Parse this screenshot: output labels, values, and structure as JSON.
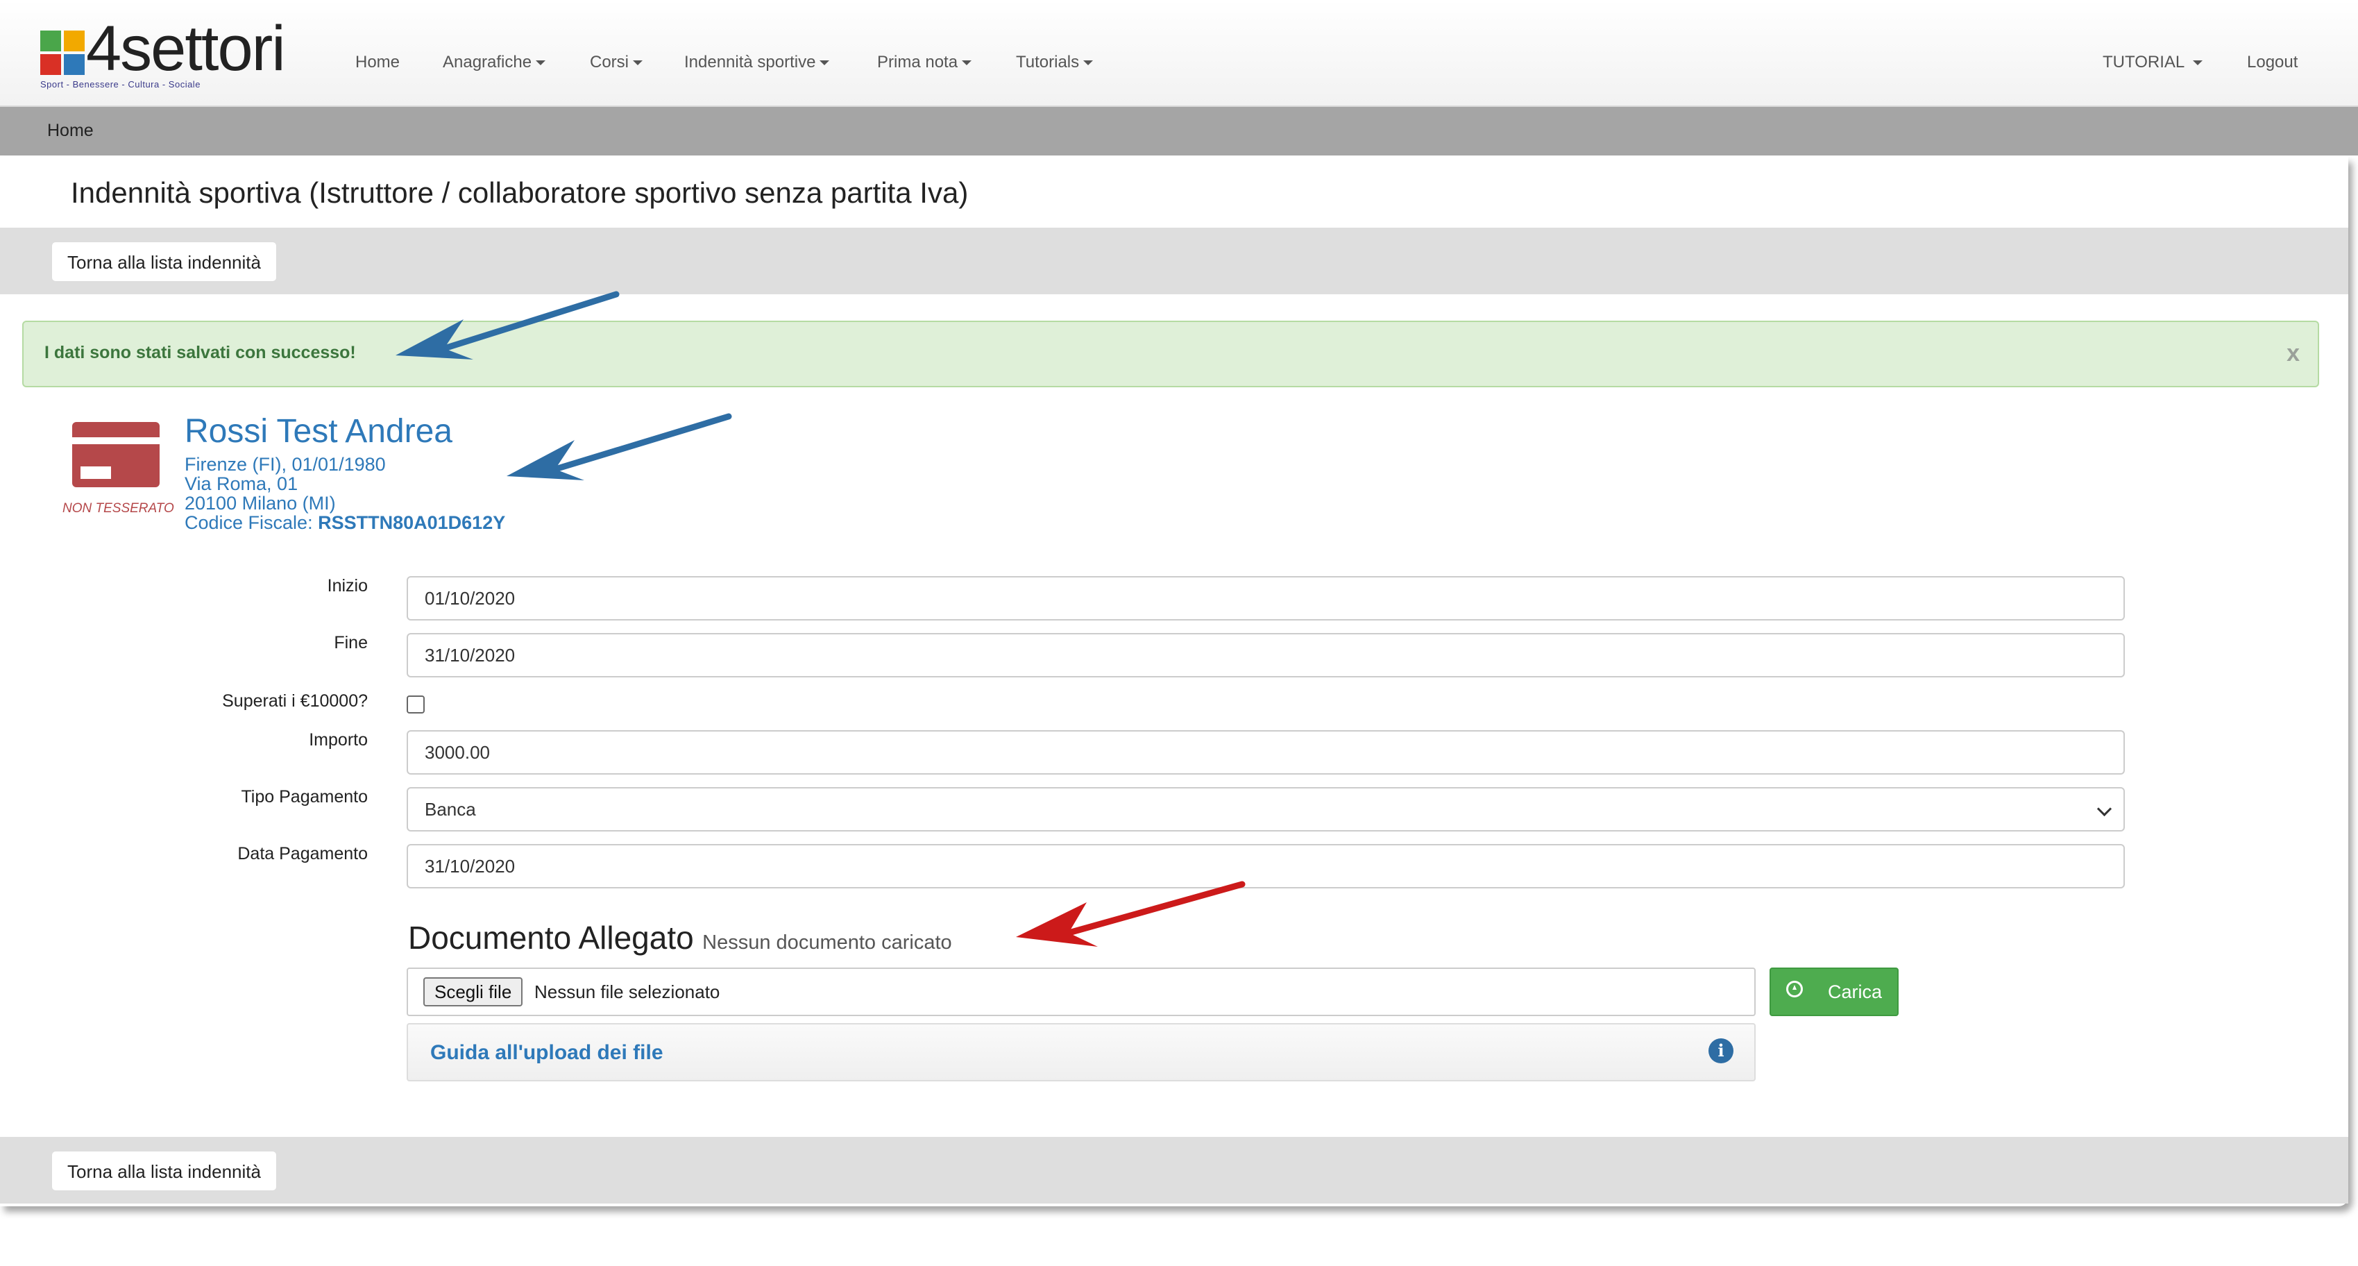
{
  "brand": {
    "name": "4settori",
    "tagline": "Sport - Benessere - Cultura - Sociale",
    "colors": [
      "#d93025",
      "#2e79b9",
      "#f2a900",
      "#4aa64a"
    ]
  },
  "nav": {
    "items": [
      {
        "label": "Home",
        "dropdown": false
      },
      {
        "label": "Anagrafiche",
        "dropdown": true
      },
      {
        "label": "Corsi",
        "dropdown": true
      },
      {
        "label": "Indennità sportive",
        "dropdown": true
      },
      {
        "label": "Prima nota",
        "dropdown": true
      },
      {
        "label": "Tutorials",
        "dropdown": true
      }
    ],
    "right": [
      {
        "label": "TUTORIAL",
        "dropdown": true
      },
      {
        "label": "Logout",
        "dropdown": false
      }
    ]
  },
  "breadcrumb": "Home",
  "page": {
    "title": "Indennità sportiva (Istruttore / collaboratore sportivo senza partita Iva)",
    "back_label": "Torna alla lista indennità",
    "alert": "I dati sono stati salvati con successo!",
    "alert_close": "x"
  },
  "member": {
    "card_status": "NON TESSERATO",
    "name": "Rossi Test Andrea",
    "birth": "Firenze (FI), 01/01/1980",
    "address": "Via Roma, 01",
    "city": "20100 Milano (MI)",
    "cf_label": "Codice Fiscale:",
    "cf_value": "RSSTTN80A01D612Y",
    "card_color": "#b5484a"
  },
  "form": {
    "inizio": {
      "label": "Inizio",
      "value": "01/10/2020"
    },
    "fine": {
      "label": "Fine",
      "value": "31/10/2020"
    },
    "superati": {
      "label": "Superati i €10000?",
      "checked": false
    },
    "importo": {
      "label": "Importo",
      "value": "3000.00"
    },
    "tipo_pagamento": {
      "label": "Tipo Pagamento",
      "value": "Banca"
    },
    "data_pagamento": {
      "label": "Data Pagamento",
      "value": "31/10/2020"
    }
  },
  "document": {
    "title": "Documento Allegato",
    "status": "Nessun documento caricato",
    "choose_label": "Scegli file",
    "file_status": "Nessun file selezionato",
    "upload_label": "Carica",
    "guide_label": "Guida all'upload dei file",
    "info_glyph": "i"
  },
  "annotations": {
    "blue": "#2e6da4",
    "red": "#cc1a1a"
  }
}
